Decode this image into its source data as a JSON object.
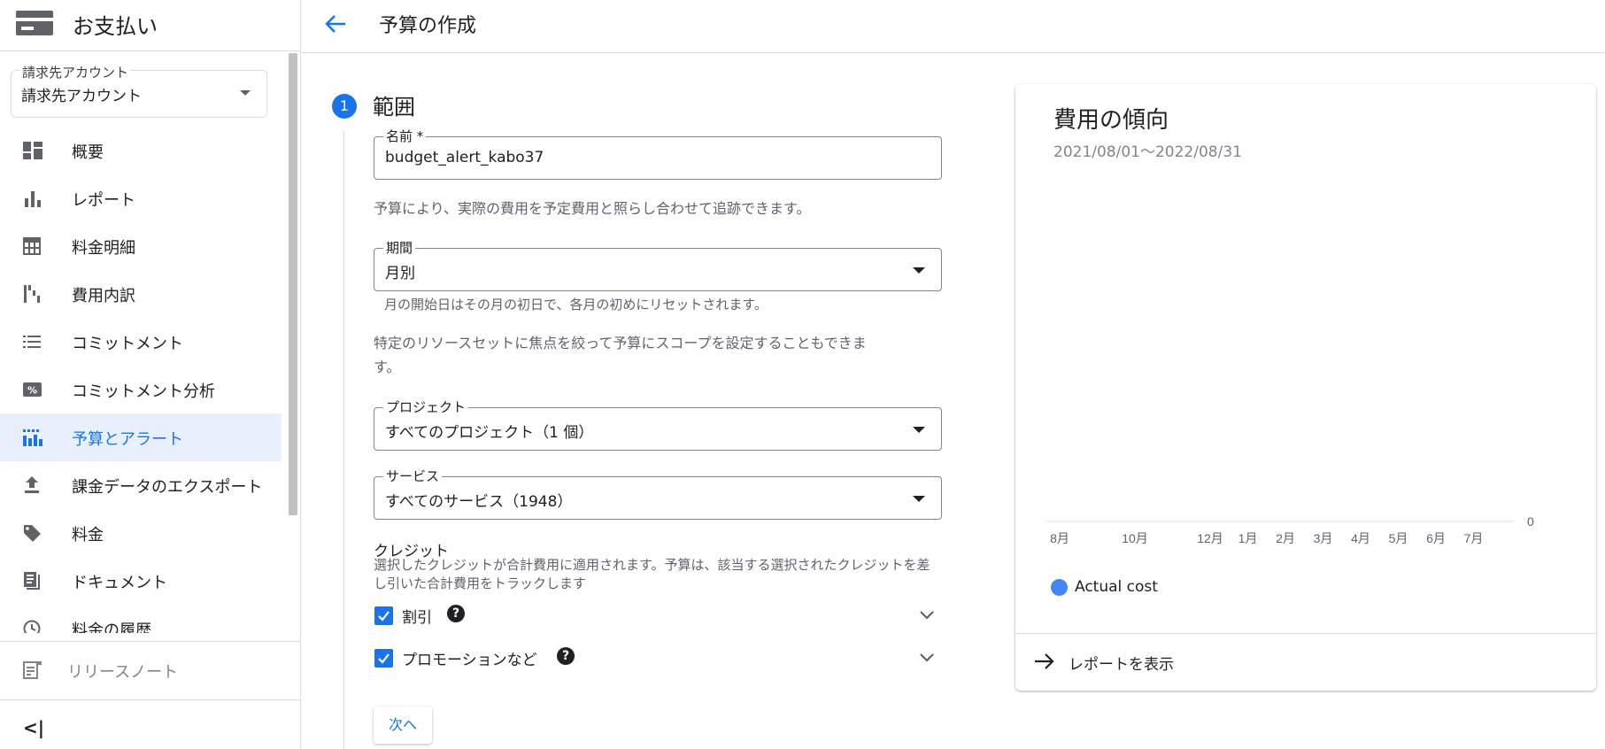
{
  "sidebar": {
    "title": "お支払い",
    "account": {
      "label": "請求先アカウント",
      "value": "請求先アカウント"
    },
    "items": [
      {
        "label": "概要",
        "icon": "dashboard-icon"
      },
      {
        "label": "レポート",
        "icon": "bar-chart-icon"
      },
      {
        "label": "料金明細",
        "icon": "table-icon"
      },
      {
        "label": "費用内訳",
        "icon": "waterfall-icon"
      },
      {
        "label": "コミットメント",
        "icon": "list-icon"
      },
      {
        "label": "コミットメント分析",
        "icon": "percent-icon"
      },
      {
        "label": "予算とアラート",
        "icon": "budget-icon",
        "active": true
      },
      {
        "label": "課金データのエクスポート",
        "icon": "upload-icon"
      },
      {
        "label": "料金",
        "icon": "tag-icon"
      },
      {
        "label": "ドキュメント",
        "icon": "document-icon"
      },
      {
        "label": "料金の履歴",
        "icon": "clock-icon"
      }
    ],
    "release_notes": "リリースノート",
    "collapse": "<|"
  },
  "header": {
    "title": "予算の作成"
  },
  "form": {
    "step_number": "1",
    "step_title": "範囲",
    "name": {
      "label": "名前 *",
      "value": "budget_alert_kabo37"
    },
    "budget_desc": "予算により、実際の費用を予定費用と照らし合わせて追跡できます。",
    "period": {
      "label": "期間",
      "value": "月別",
      "hint": "月の開始日はその月の初日で、各月の初めにリセットされます。"
    },
    "scope_desc_line1": "特定のリソースセットに焦点を絞って予算にスコープを設定することもできま",
    "scope_desc_line2": "す。",
    "project": {
      "label": "プロジェクト",
      "value": "すべてのプロジェクト（1 個）"
    },
    "service": {
      "label": "サービス",
      "value": "すべてのサービス（1948）"
    },
    "credit": {
      "title": "クレジット",
      "desc": "選択したクレジットが合計費用に適用されます。予算は、該当する選択されたクレジットを差し引いた合計費用をトラックします",
      "options": [
        {
          "label": "割引",
          "checked": true
        },
        {
          "label": "プロモーションなど",
          "checked": true
        }
      ]
    },
    "next_button": "次へ"
  },
  "card": {
    "title": "費用の傾向",
    "date_range": "2021/08/01～2022/08/31",
    "view_report": "レポートを表示"
  },
  "chart_data": {
    "type": "line",
    "x": [
      "8月",
      "10月",
      "12月",
      "1月",
      "2月",
      "3月",
      "4月",
      "5月",
      "6月",
      "7月"
    ],
    "series": [
      {
        "name": "Actual cost",
        "values": [
          0,
          0,
          0,
          0,
          0,
          0,
          0,
          0,
          0,
          0
        ]
      }
    ],
    "y_tick": "0",
    "color": "#4285f4"
  }
}
